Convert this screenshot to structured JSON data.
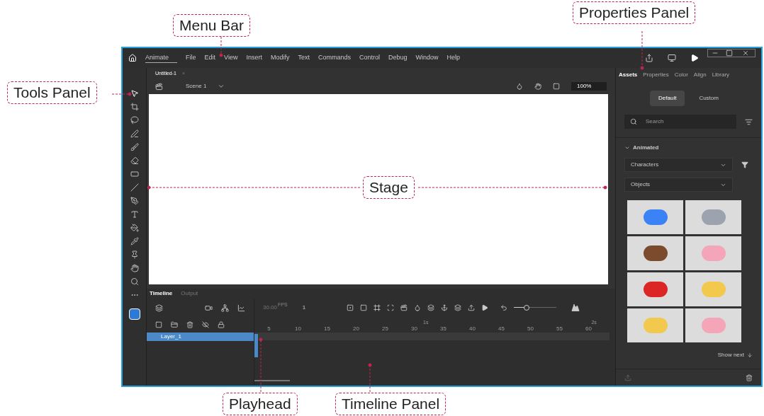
{
  "annotations": [
    {
      "kind": "menu",
      "label": "Menu Bar"
    },
    {
      "kind": "properties",
      "label": "Properties Panel"
    },
    {
      "kind": "tools",
      "label": "Tools Panel"
    },
    {
      "kind": "stage",
      "label": "Stage"
    },
    {
      "kind": "playhead",
      "label": "Playhead"
    },
    {
      "kind": "timeline",
      "label": "Timeline Panel"
    }
  ],
  "menu_bar": {
    "workspace": "Animate",
    "items": [
      "File",
      "Edit",
      "View",
      "Insert",
      "Modify",
      "Text",
      "Commands",
      "Control",
      "Debug",
      "Window",
      "Help"
    ]
  },
  "document_tab": {
    "title": "Untitled-1",
    "close": "×"
  },
  "edit_bar": {
    "scene": "Scene 1",
    "zoom": "100%"
  },
  "properties_panel": {
    "tabs": [
      {
        "label": "Assets",
        "selected": true
      },
      {
        "label": "Properties",
        "selected": false
      },
      {
        "label": "Color",
        "selected": false
      },
      {
        "label": "Align",
        "selected": false
      },
      {
        "label": "Library",
        "selected": false
      }
    ],
    "modes": [
      {
        "label": "Default",
        "selected": true
      },
      {
        "label": "Custom",
        "selected": false
      }
    ],
    "search": {
      "placeholder": "Search"
    },
    "section": {
      "title": "Animated",
      "expanded": true
    },
    "dropdowns": [
      "Characters",
      "Objects"
    ],
    "show_next": "Show next"
  },
  "timeline": {
    "tabs": [
      {
        "label": "Timeline",
        "selected": true
      },
      {
        "label": "Output",
        "selected": false
      }
    ],
    "fps": "30.00",
    "fps_unit": "FPS",
    "frame": "1",
    "time_markers": [
      "1s",
      "2s"
    ],
    "ticks": [
      "5",
      "10",
      "15",
      "20",
      "25",
      "30",
      "35",
      "40",
      "45",
      "50",
      "55",
      "60"
    ],
    "layers": [
      {
        "name": "Layer_1",
        "selected": true
      }
    ],
    "frame_zoom": {
      "level": 0.3
    }
  }
}
